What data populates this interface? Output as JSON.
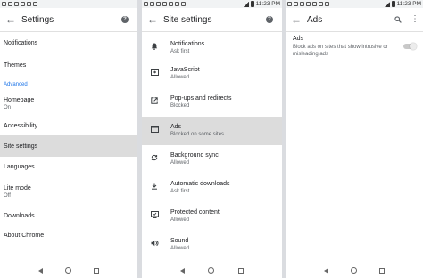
{
  "status": {
    "time": "11:23 PM"
  },
  "panel1": {
    "title": "Settings",
    "items": [
      {
        "label": "Notifications",
        "sub": ""
      },
      {
        "label": "Themes",
        "sub": ""
      },
      {
        "label": "Advanced",
        "sub": ""
      },
      {
        "label": "Homepage",
        "sub": "On"
      },
      {
        "label": "Accessibility",
        "sub": ""
      },
      {
        "label": "Site settings",
        "sub": ""
      },
      {
        "label": "Languages",
        "sub": ""
      },
      {
        "label": "Lite mode",
        "sub": "Off"
      },
      {
        "label": "Downloads",
        "sub": ""
      },
      {
        "label": "About Chrome",
        "sub": ""
      }
    ]
  },
  "panel2": {
    "title": "Site settings",
    "items": [
      {
        "label": "Notifications",
        "sub": "Ask first",
        "icon": "bell-icon"
      },
      {
        "label": "JavaScript",
        "sub": "Allowed",
        "icon": "javascript-icon"
      },
      {
        "label": "Pop-ups and redirects",
        "sub": "Blocked",
        "icon": "popup-icon"
      },
      {
        "label": "Ads",
        "sub": "Blocked on some sites",
        "icon": "ads-icon"
      },
      {
        "label": "Background sync",
        "sub": "Allowed",
        "icon": "sync-icon"
      },
      {
        "label": "Automatic downloads",
        "sub": "Ask first",
        "icon": "download-icon"
      },
      {
        "label": "Protected content",
        "sub": "Allowed",
        "icon": "protected-content-icon"
      },
      {
        "label": "Sound",
        "sub": "Allowed",
        "icon": "speaker-icon"
      }
    ]
  },
  "panel3": {
    "title": "Ads",
    "setting_title": "Ads",
    "setting_desc": "Block ads on sites that show intrusive or misleading ads",
    "toggle_on": false
  }
}
